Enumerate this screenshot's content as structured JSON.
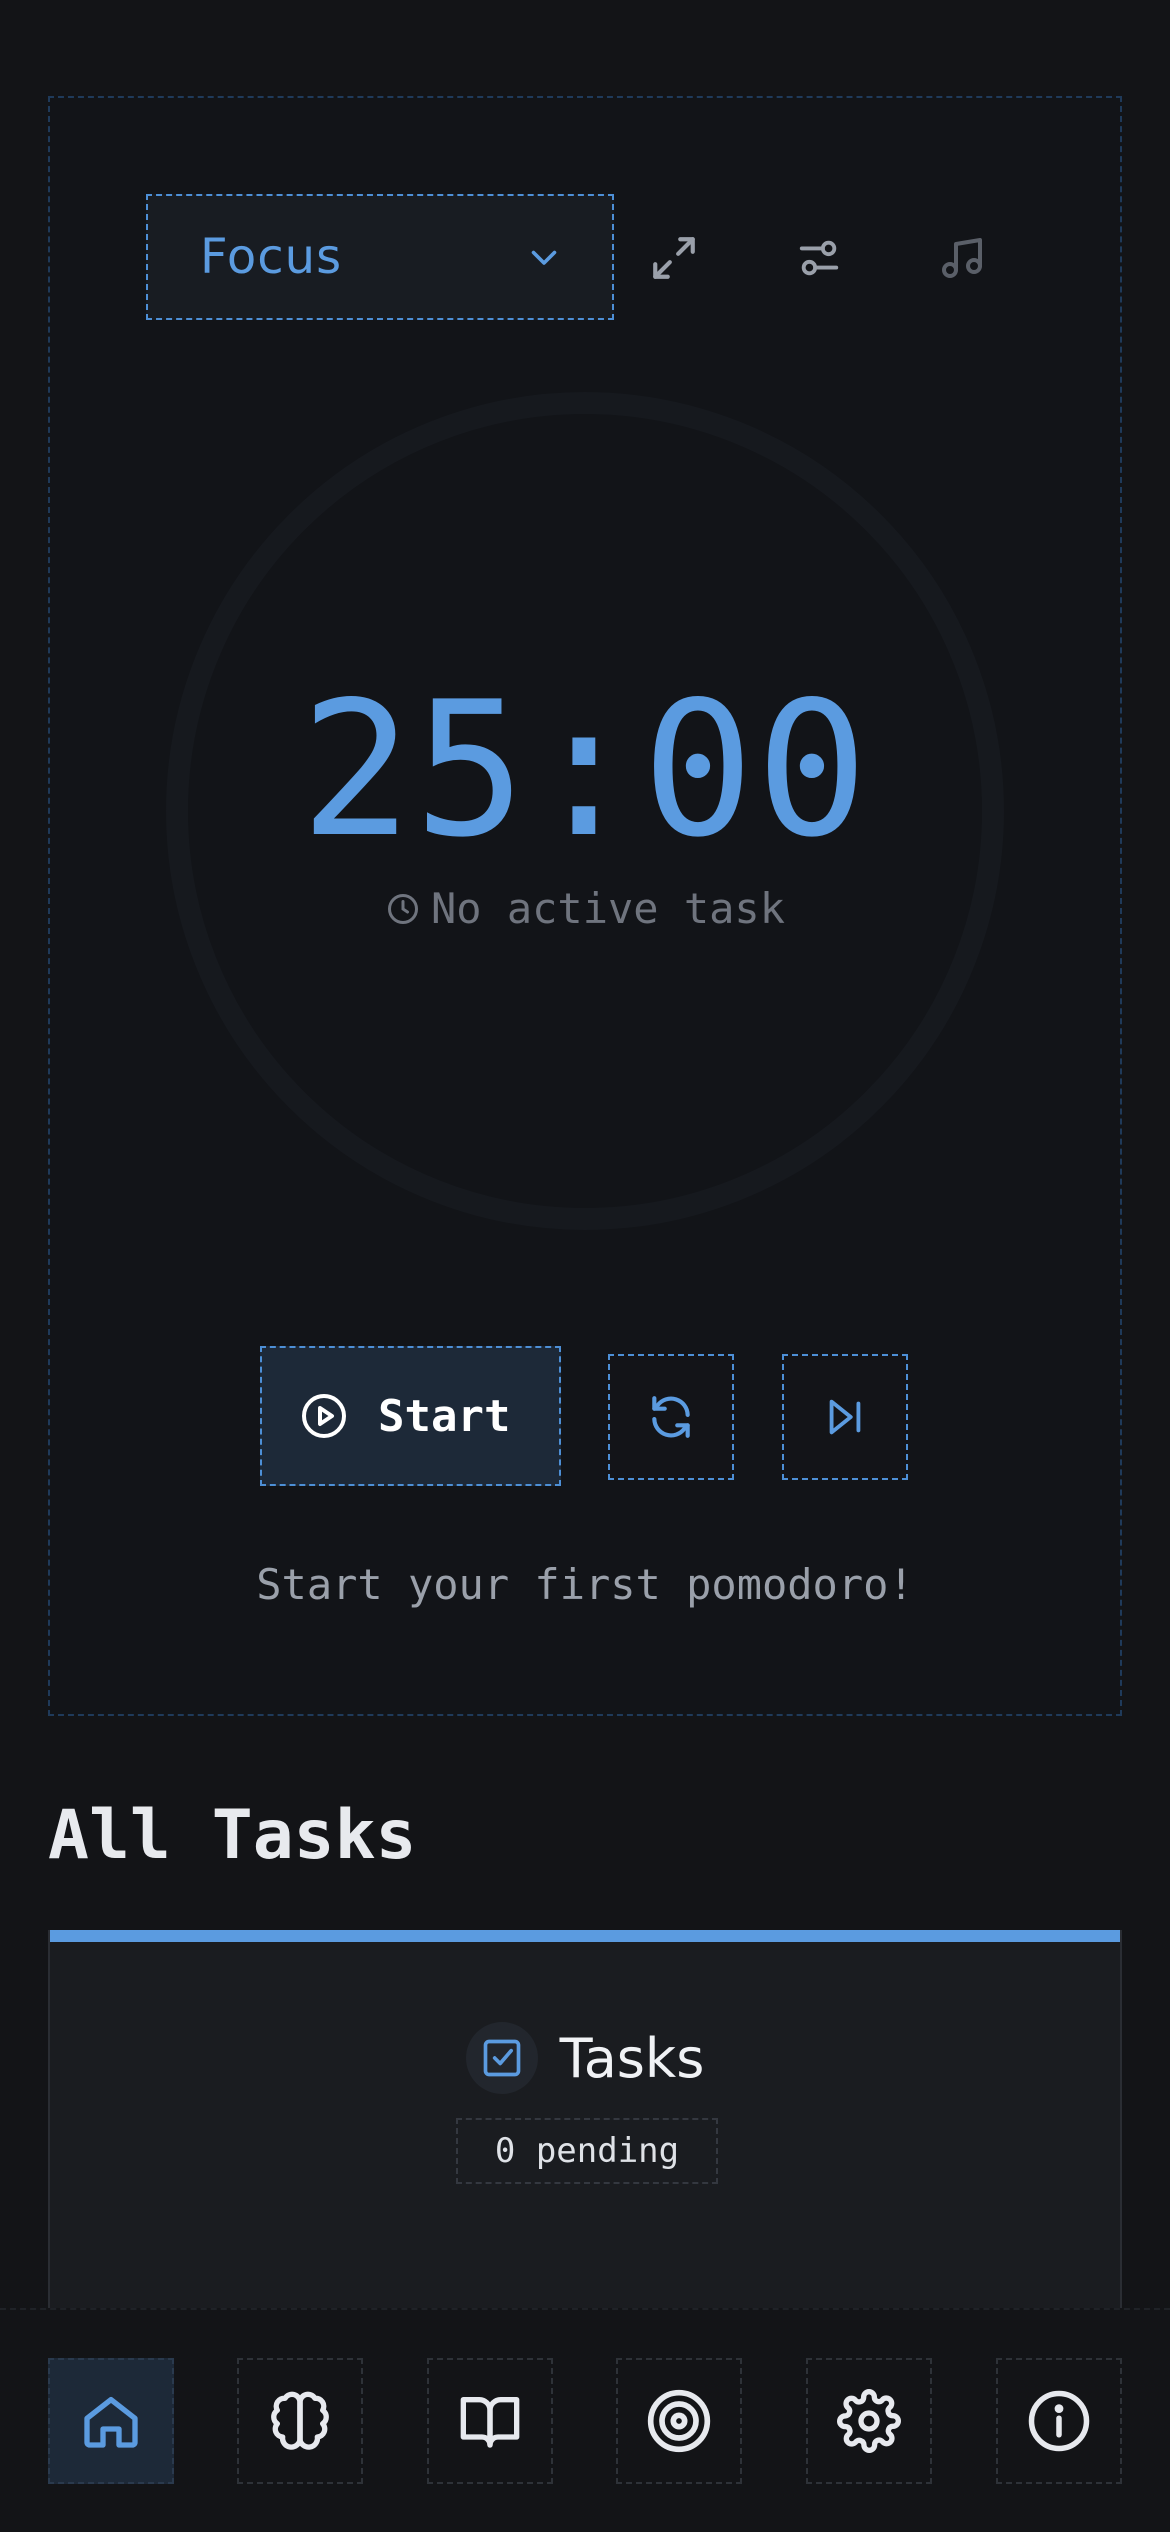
{
  "timer": {
    "mode": "Focus",
    "time": "25:00",
    "task_status": "No active task",
    "start_label": "Start",
    "hint": "Start your first pomodoro!"
  },
  "tasks_section": {
    "title": "All Tasks",
    "card_title": "Tasks",
    "pending": "0 pending"
  },
  "nav": {
    "items": [
      "home-icon",
      "brain-icon",
      "book-icon",
      "target-icon",
      "settings-icon",
      "info-icon"
    ],
    "active": "home-icon"
  },
  "colors": {
    "accent": "#5b9be0",
    "background": "#131417",
    "muted": "#6f747e"
  }
}
